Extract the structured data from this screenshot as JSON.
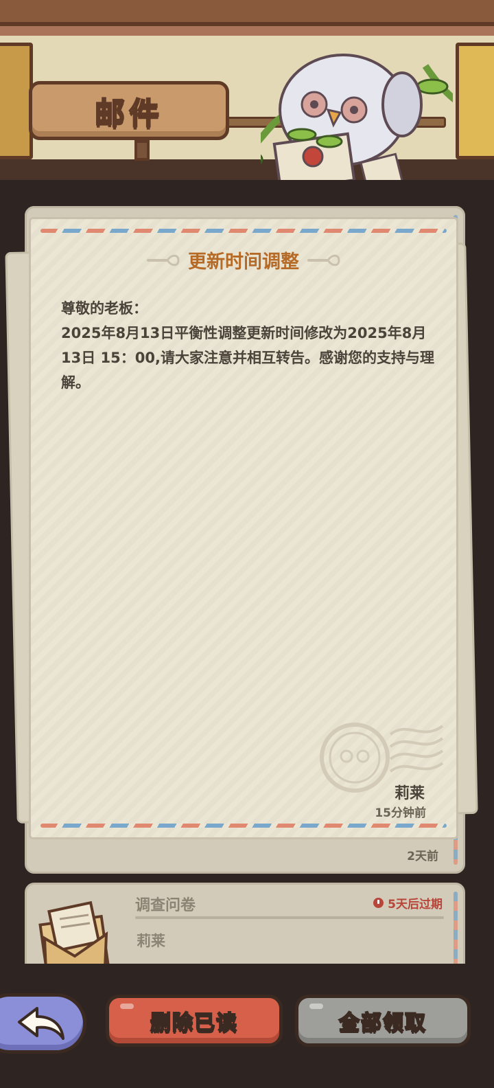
{
  "header": {
    "title": "邮件"
  },
  "letter": {
    "title": "更新时间调整",
    "body": "尊敬的老板：\n2025年8月13日平衡性调整更新时间修改为2025年8月13日 15：00,请大家注意并相互转告。感谢您的支持与理解。",
    "sender": "莉莱",
    "time": "15分钟前"
  },
  "mail_list": {
    "item1": {
      "time": "2天前"
    },
    "item2": {
      "title": "调查问卷",
      "sender": "莉莱",
      "expire": "5天后过期"
    }
  },
  "buttons": {
    "delete_read": "删除已读",
    "claim_all": "全部领取"
  },
  "colors": {
    "accent_title": "#b56b27",
    "danger": "#b8453a",
    "delete_button": "#d6604a",
    "claim_button": "#9e9e9a",
    "back_button": "#8b8fd8"
  },
  "icons": [
    "back-arrow-icon",
    "clock-icon",
    "envelope-icon",
    "stamp-icon",
    "owl-mascot-icon"
  ]
}
